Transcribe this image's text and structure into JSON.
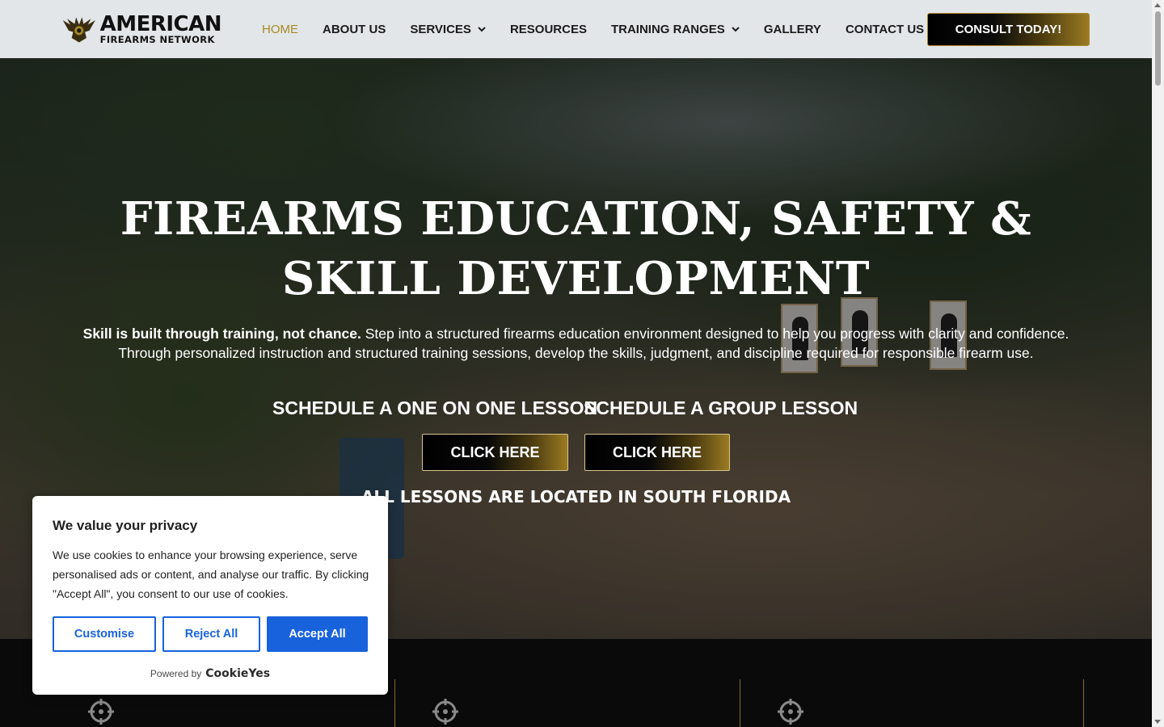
{
  "header": {
    "logo_primary": "AMERICAN",
    "logo_secondary": "FIREARMS NETWORK",
    "nav": [
      {
        "label": "HOME",
        "active": true,
        "dropdown": false
      },
      {
        "label": "ABOUT US",
        "active": false,
        "dropdown": false
      },
      {
        "label": "SERVICES",
        "active": false,
        "dropdown": true
      },
      {
        "label": "RESOURCES",
        "active": false,
        "dropdown": false
      },
      {
        "label": "TRAINING RANGES",
        "active": false,
        "dropdown": true
      },
      {
        "label": "GALLERY",
        "active": false,
        "dropdown": false
      },
      {
        "label": "CONTACT US",
        "active": false,
        "dropdown": false
      }
    ],
    "cta_label": "CONSULT TODAY!"
  },
  "hero": {
    "title_line1": "FIREARMS EDUCATION, SAFETY &",
    "title_line2": "SKILL DEVELOPMENT",
    "desc_bold": "Skill is built through training, not chance.",
    "desc_rest": "Step into a structured firearms education environment designed to help you progress with clarity and confidence.",
    "desc_line2": "Through personalized instruction and structured training sessions, develop the skills, judgment, and discipline required for responsible firearm use.",
    "one_on_one_label": "SCHEDULE A ONE ON ONE LESSON",
    "group_label": "SCHEDULE A GROUP LESSON",
    "one_on_one_button": "CLICK HERE",
    "group_button": "CLICK HERE",
    "location_note": "ALL LESSONS ARE LOCATED IN SOUTH FLORIDA"
  },
  "cookie_banner": {
    "title": "We value your privacy",
    "text": "We use cookies to enhance your browsing experience, serve personalised ads or content, and analyse our traffic. By clicking \"Accept All\", you consent to our use of cookies.",
    "customise_label": "Customise",
    "reject_label": "Reject All",
    "accept_label": "Accept All",
    "powered_by": "Powered by",
    "brand": "CookieYes"
  },
  "colors": {
    "accent_gold": "#a58a24",
    "cookie_blue": "#1863dc",
    "header_bg": "#e3e6e8"
  }
}
